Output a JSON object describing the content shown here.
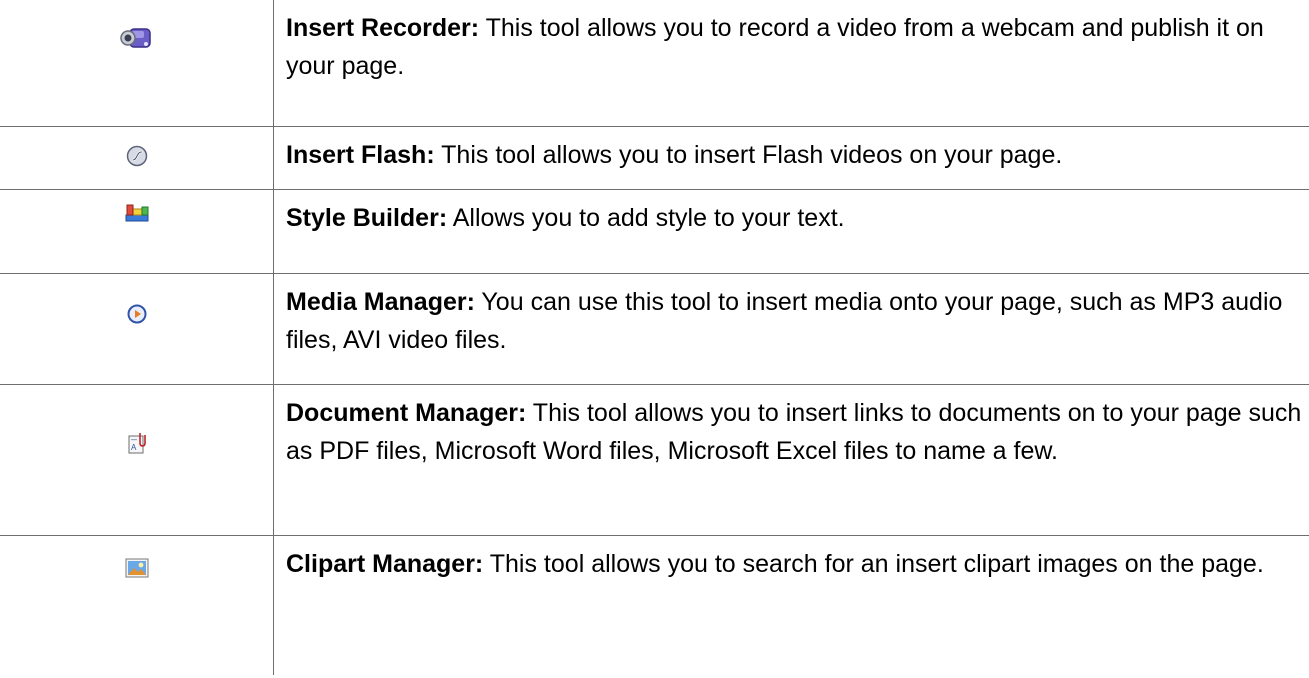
{
  "tools": [
    {
      "icon": "camcorder-icon",
      "name": "Insert Recorder:",
      "description": " This tool allows you to record a video from a webcam and publish it on your page."
    },
    {
      "icon": "flash-icon",
      "name": "Insert Flash:",
      "description": " This tool allows you to insert Flash videos on your page."
    },
    {
      "icon": "style-builder-icon",
      "name": "Style Builder:",
      "description": " Allows you to add style to your text."
    },
    {
      "icon": "media-player-icon",
      "name": "Media Manager:",
      "description": " You can use this tool to insert media onto your page, such as MP3 audio files, AVI video files."
    },
    {
      "icon": "document-attachment-icon",
      "name": "Document Manager:",
      "description": " This tool allows you to insert links to documents on to your page such as PDF files, Microsoft Word files, Microsoft Excel files to name a few."
    },
    {
      "icon": "clipart-image-icon",
      "name": "Clipart Manager:",
      "description": " This tool allows you to search for an insert clipart images on the page."
    }
  ],
  "colors": {
    "border": "#6f6f6f",
    "text": "#000000"
  }
}
